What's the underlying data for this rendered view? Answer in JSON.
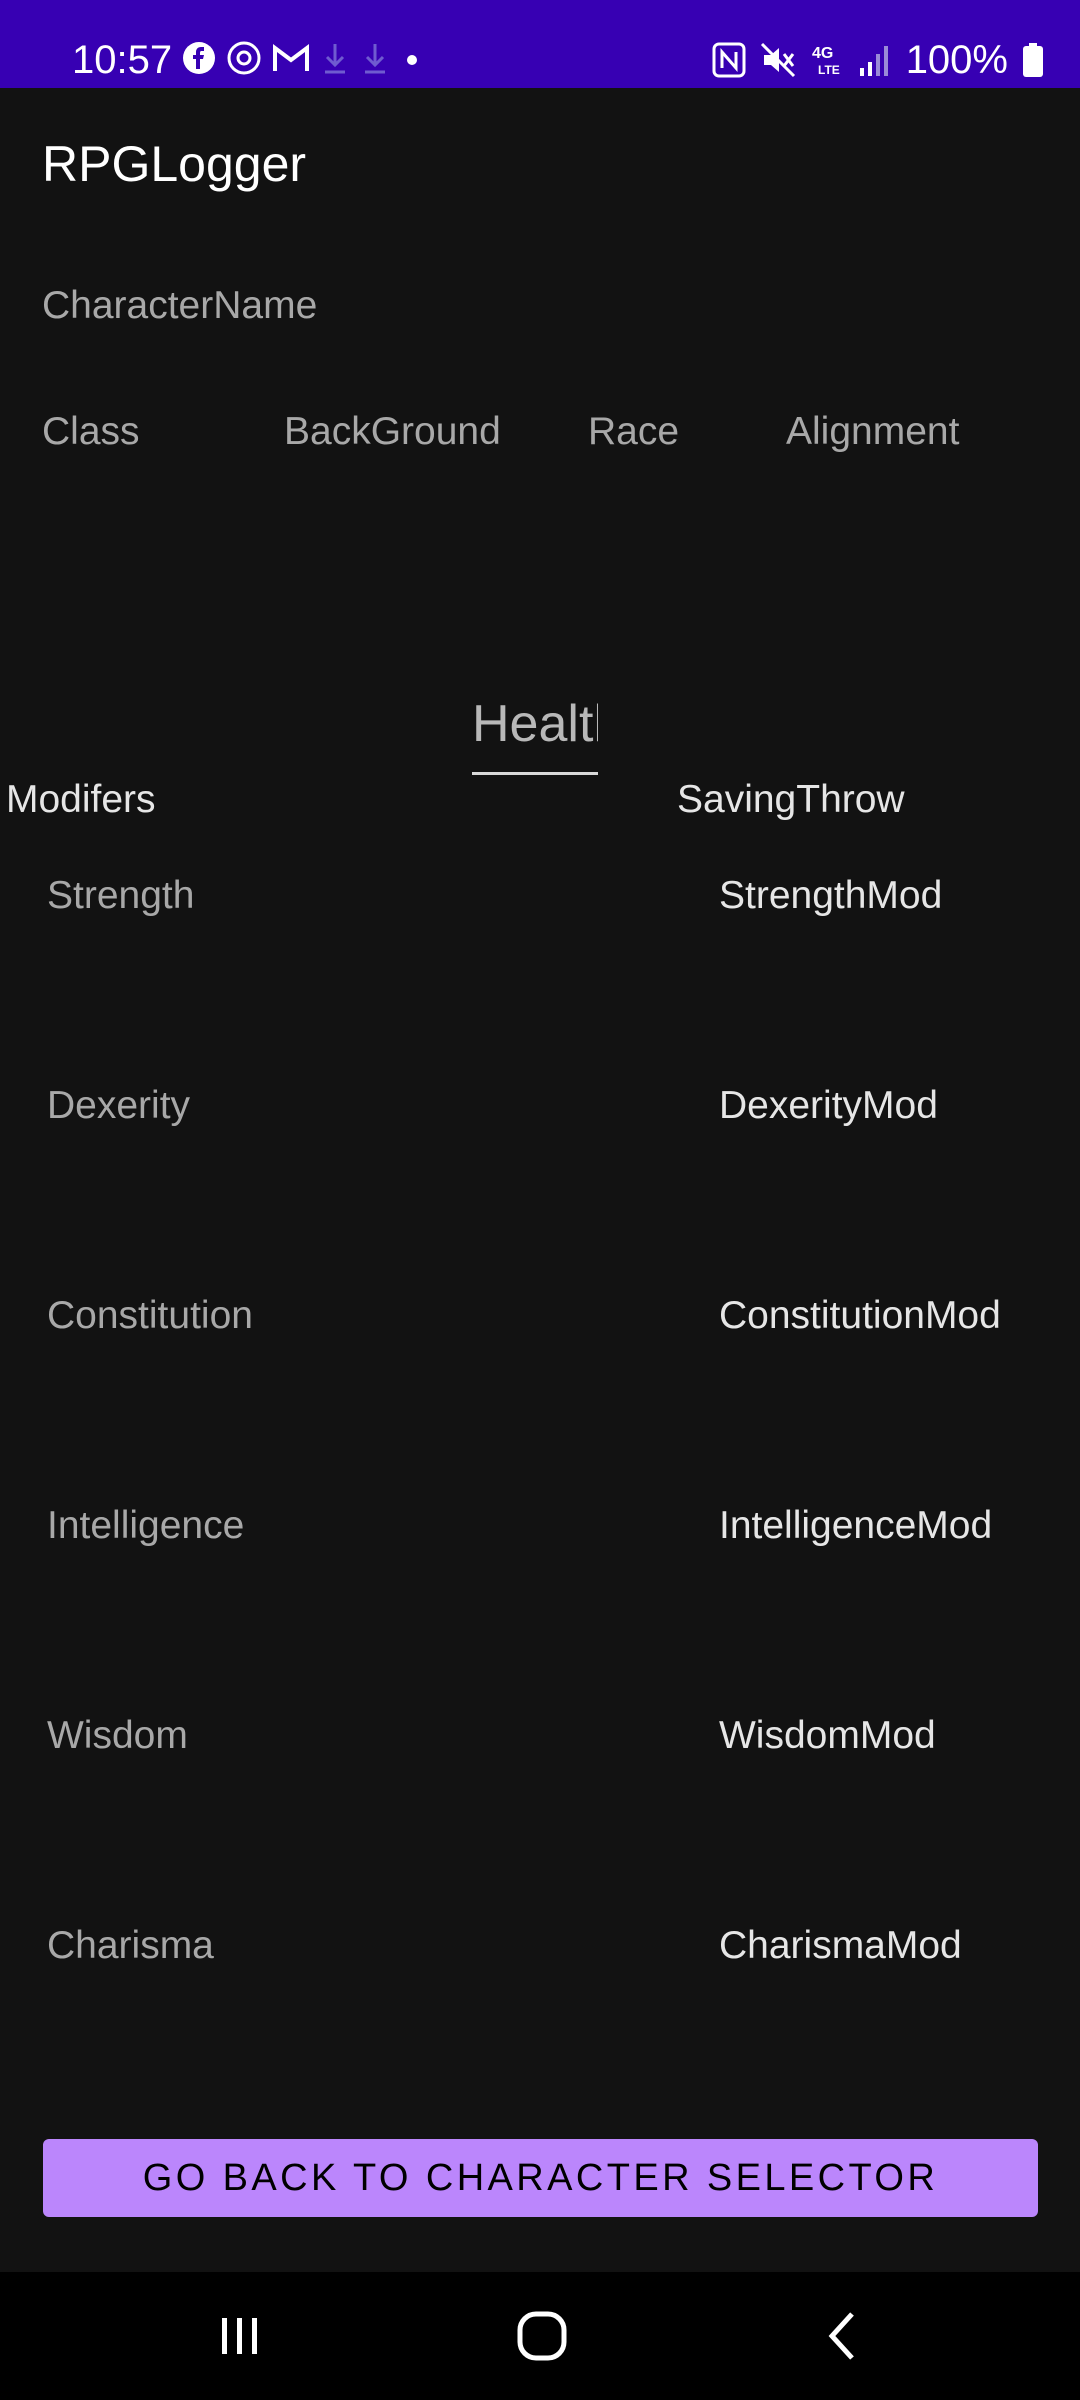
{
  "status_bar": {
    "time": "10:57",
    "battery": "100%",
    "left_icons": [
      "facebook-icon",
      "threads-icon",
      "gmail-icon",
      "download-icon",
      "download-icon",
      "dot-icon"
    ],
    "right_icons": [
      "nfc-icon",
      "mute-icon",
      "lte-icon",
      "signal-icon",
      "battery-icon"
    ],
    "background": "#3700B3"
  },
  "app_bar": {
    "title": "RPGLogger"
  },
  "form": {
    "character_name_placeholder": "CharacterName",
    "class_placeholder": "Class",
    "background_placeholder": "BackGround",
    "race_placeholder": "Race",
    "alignment_placeholder": "Alignment",
    "health_placeholder": "Health"
  },
  "labels": {
    "modifiers": "Modifers",
    "saving_throw": "SavingThrow"
  },
  "stats": [
    {
      "name": "Strength",
      "mod": "StrengthMod"
    },
    {
      "name": "Dexerity",
      "mod": "DexerityMod"
    },
    {
      "name": "Constitution",
      "mod": "ConstitutionMod"
    },
    {
      "name": "Intelligence",
      "mod": "IntelligenceMod"
    },
    {
      "name": "Wisdom",
      "mod": "WisdomMod"
    },
    {
      "name": "Charisma",
      "mod": "CharismaMod"
    }
  ],
  "button": {
    "label": "GO BACK TO CHARACTER SELECTOR",
    "color": "#BB86FC"
  },
  "nav_bar": {
    "buttons": [
      "recent-apps-icon",
      "home-icon",
      "back-icon"
    ]
  }
}
